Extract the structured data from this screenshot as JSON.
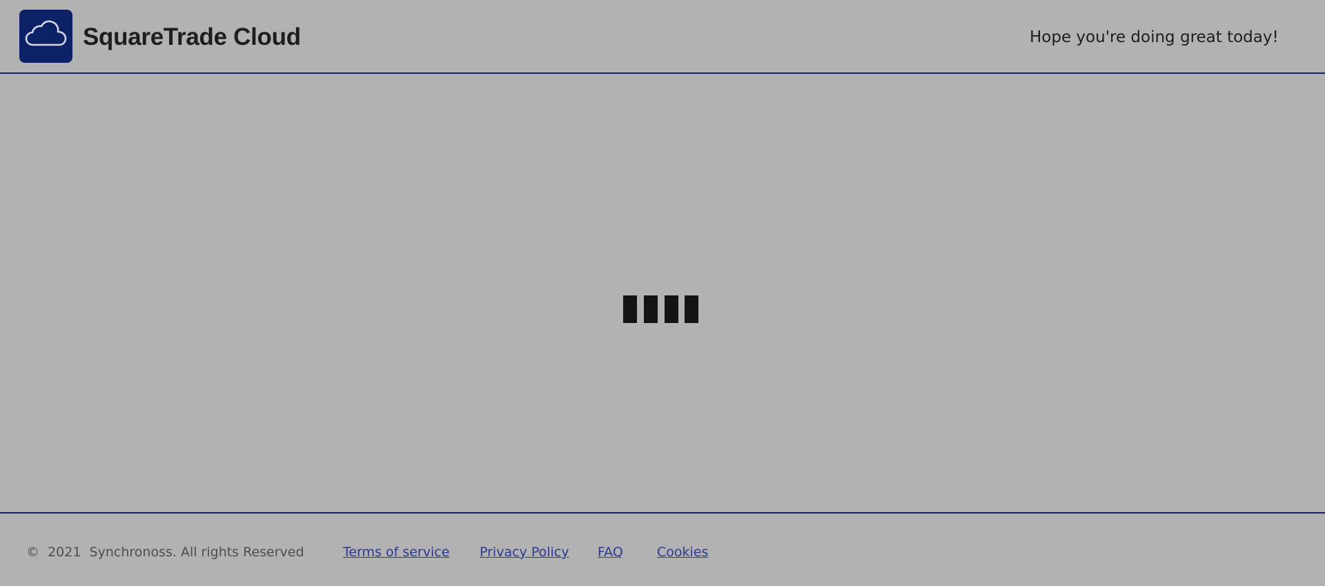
{
  "header": {
    "brand_name": "SquareTrade Cloud",
    "logo_icon": "cloud-icon",
    "greeting": "Hope you're doing great today!"
  },
  "main": {
    "loader_icon": "loading-bars-icon"
  },
  "footer": {
    "copyright_symbol": "©",
    "copyright_year": "2021",
    "copyright_text": "Synchronoss. All rights Reserved",
    "links": [
      {
        "label": "Terms of service"
      },
      {
        "label": "Privacy Policy"
      },
      {
        "label": "FAQ"
      },
      {
        "label": "Cookies"
      }
    ]
  },
  "colors": {
    "background": "#b2b2b2",
    "brand_navy": "#0d2266",
    "divider": "#0e2470",
    "link": "#2b3a8c",
    "loader": "#141414"
  }
}
